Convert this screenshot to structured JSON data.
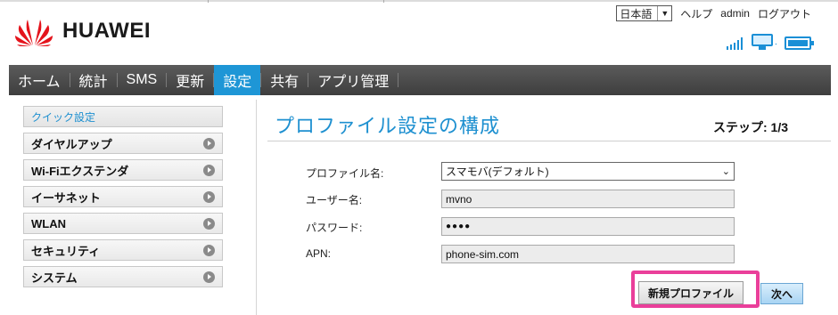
{
  "header": {
    "brand": "HUAWEI",
    "language": "日本語",
    "help": "ヘルプ",
    "user": "admin",
    "logout": "ログアウト"
  },
  "status": {
    "signal_icon": "signal-bars-icon",
    "connection_icon": "monitor-connected-icon",
    "battery_icon": "battery-icon",
    "accent_color": "#1e90d0"
  },
  "nav": {
    "items": [
      {
        "label": "ホーム"
      },
      {
        "label": "統計"
      },
      {
        "label": "SMS"
      },
      {
        "label": "更新"
      },
      {
        "label": "設定"
      },
      {
        "label": "共有"
      },
      {
        "label": "アプリ管理"
      }
    ],
    "active_index": 4
  },
  "sidebar": {
    "items": [
      {
        "label": "クイック設定"
      },
      {
        "label": "ダイヤルアップ"
      },
      {
        "label": "Wi-Fiエクステンダ"
      },
      {
        "label": "イーサネット"
      },
      {
        "label": "WLAN"
      },
      {
        "label": "セキュリティ"
      },
      {
        "label": "システム"
      }
    ]
  },
  "main": {
    "title": "プロファイル設定の構成",
    "step": "ステップ: 1/3",
    "form": {
      "profile_label": "プロファイル名:",
      "profile_value": "スマモバ(デフォルト)",
      "username_label": "ユーザー名:",
      "username_value": "mvno",
      "password_label": "パスワード:",
      "password_value": "●●●●",
      "apn_label": "APN:",
      "apn_value": "phone-sim.com"
    },
    "buttons": {
      "new_profile": "新規プロファイル",
      "next": "次へ"
    }
  }
}
